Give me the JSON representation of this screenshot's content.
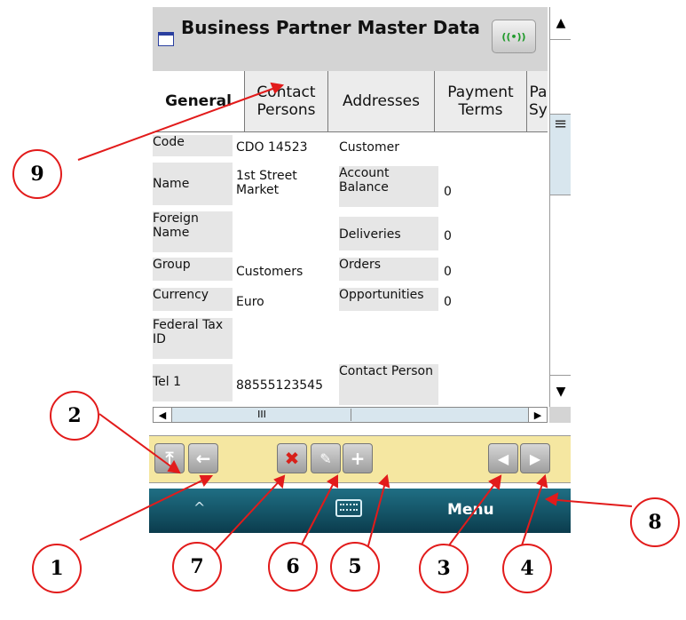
{
  "window": {
    "title": "Business Partner Master Data",
    "sync_icon": "((•))"
  },
  "tabs": [
    {
      "label": "General",
      "active": true
    },
    {
      "label": "Contact\nPersons"
    },
    {
      "label": "Addresses"
    },
    {
      "label": "Payment\nTerms"
    },
    {
      "label": "Pa\nSy"
    }
  ],
  "fields": {
    "code_label": "Code",
    "code_value": "CDO 14523",
    "code_type": "Customer",
    "name_label": "Name",
    "name_value": "1st Street Market",
    "balance_label": "Account Balance",
    "balance_value": "0",
    "foreign_label": "Foreign Name",
    "deliveries_label": "Deliveries",
    "deliveries_value": "0",
    "group_label": "Group",
    "group_value": "Customers",
    "orders_label": "Orders",
    "orders_value": "0",
    "currency_label": "Currency",
    "currency_value": "Euro",
    "opps_label": "Opportunities",
    "opps_value": "0",
    "tax_label": "Federal Tax ID",
    "tel_label": "Tel 1",
    "tel_value": "88555123545",
    "contact_label": "Contact Person"
  },
  "scroll": {
    "up": "▲",
    "down": "▼",
    "left": "◀",
    "right": "▶",
    "grip": "≡",
    "hgrip": "III"
  },
  "toolbar": {
    "first": "⤒",
    "back": "←",
    "delete": "✖",
    "edit": "✎",
    "add": "+",
    "prev": "◀",
    "next": "▶"
  },
  "softkeys": {
    "up": "^",
    "menu": "Menu"
  },
  "callouts": [
    "9",
    "2",
    "1",
    "7",
    "6",
    "5",
    "3",
    "4",
    "8"
  ],
  "colors": {
    "accent": "#e21b1b",
    "toolbar": "#f5e7a1",
    "softbar": "#0b3c4d"
  }
}
